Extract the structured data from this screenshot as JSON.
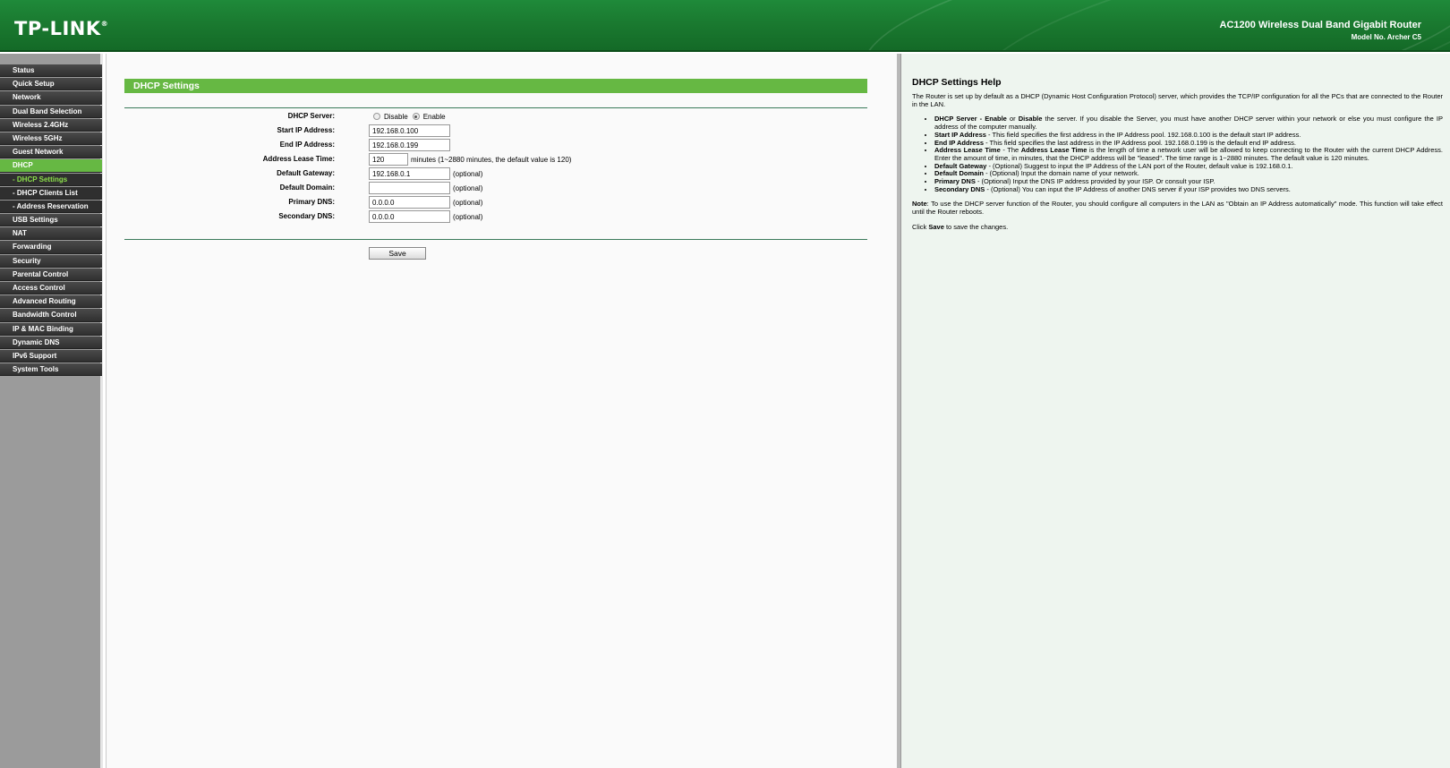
{
  "header": {
    "logo_text": "TP-LINK",
    "logo_mark": "®",
    "product_name": "AC1200 Wireless Dual Band Gigabit Router",
    "model_no": "Model No. Archer C5"
  },
  "sidebar": {
    "items": [
      {
        "label": "Status"
      },
      {
        "label": "Quick Setup"
      },
      {
        "label": "Network"
      },
      {
        "label": "Dual Band Selection"
      },
      {
        "label": "Wireless 2.4GHz"
      },
      {
        "label": "Wireless 5GHz"
      },
      {
        "label": "Guest Network"
      },
      {
        "label": "DHCP"
      },
      {
        "label": "- DHCP Settings"
      },
      {
        "label": "- DHCP Clients List"
      },
      {
        "label": "- Address Reservation"
      },
      {
        "label": "USB Settings"
      },
      {
        "label": "NAT"
      },
      {
        "label": "Forwarding"
      },
      {
        "label": "Security"
      },
      {
        "label": "Parental Control"
      },
      {
        "label": "Access Control"
      },
      {
        "label": "Advanced Routing"
      },
      {
        "label": "Bandwidth Control"
      },
      {
        "label": "IP & MAC Binding"
      },
      {
        "label": "Dynamic DNS"
      },
      {
        "label": "IPv6 Support"
      },
      {
        "label": "System Tools"
      }
    ],
    "active": "DHCP",
    "active_sub": "- DHCP Settings"
  },
  "main": {
    "section_title": "DHCP Settings",
    "dhcp_server": {
      "label": "DHCP Server:",
      "option_disable": "Disable",
      "option_enable": "Enable",
      "selected": "Enable"
    },
    "start_ip": {
      "label": "Start IP Address:",
      "value": "192.168.0.100"
    },
    "end_ip": {
      "label": "End IP Address:",
      "value": "192.168.0.199"
    },
    "lease_time": {
      "label": "Address Lease Time:",
      "value": "120",
      "hint": "minutes (1~2880 minutes, the default value is 120)"
    },
    "gateway": {
      "label": "Default Gateway:",
      "value": "192.168.0.1",
      "hint": "(optional)"
    },
    "domain": {
      "label": "Default Domain:",
      "value": "",
      "hint": "(optional)"
    },
    "primary_dns": {
      "label": "Primary DNS:",
      "value": "0.0.0.0",
      "hint": "(optional)"
    },
    "secondary_dns": {
      "label": "Secondary DNS:",
      "value": "0.0.0.0",
      "hint": "(optional)"
    },
    "save_label": "Save"
  },
  "help": {
    "title": "DHCP Settings Help",
    "intro": "The Router is set up by default as a DHCP (Dynamic Host Configuration Protocol) server, which provides the TCP/IP configuration for all the PCs that are connected to the Router in the LAN.",
    "items": [
      {
        "term": "DHCP Server - Enable",
        "text_mid": " or ",
        "term2": "Disable",
        "text": " the server. If you disable the Server, you must have another DHCP server within your network or else you must configure the IP address of the computer manually."
      },
      {
        "term": "Start IP Address",
        "text": " - This field specifies the first address in the IP Address pool. 192.168.0.100 is the default start IP address."
      },
      {
        "term": "End IP Address",
        "text": " - This field specifies the last address in the IP Address pool. 192.168.0.199 is the default end IP address."
      },
      {
        "term": "Address Lease Time",
        "text_mid": " - The ",
        "term2": "Address Lease Time",
        "text": " is the length of time a network user will be allowed to keep connecting to the Router with the current DHCP Address. Enter the amount of time, in minutes, that the DHCP address will be \"leased\". The time range is 1~2880 minutes. The default value is 120 minutes."
      },
      {
        "term": "Default Gateway",
        "text": " - (Optional) Suggest to input the IP Address of the LAN port of the Router, default value is 192.168.0.1."
      },
      {
        "term": "Default Domain",
        "text": " - (Optional) Input the domain name of your network."
      },
      {
        "term": "Primary DNS",
        "text": " - (Optional) Input the DNS IP address provided by your ISP. Or consult your ISP."
      },
      {
        "term": "Secondary DNS",
        "text": " - (Optional) You can input the IP Address of another DNS server if your ISP provides two DNS servers."
      }
    ],
    "note_label": "Note",
    "note_text": ": To use the DHCP server function of the Router, you should configure all computers in the LAN as \"Obtain an IP Address automatically\" mode. This function will take effect until the Router reboots.",
    "click_pre": "Click ",
    "click_save": "Save",
    "click_post": " to save the changes."
  },
  "colors": {
    "header_green": "#1a7a30",
    "accent_green": "#66b843",
    "sidebar_bg": "#9b9b9b",
    "nav_dark": "#303030",
    "help_bg": "#eef5ef"
  }
}
